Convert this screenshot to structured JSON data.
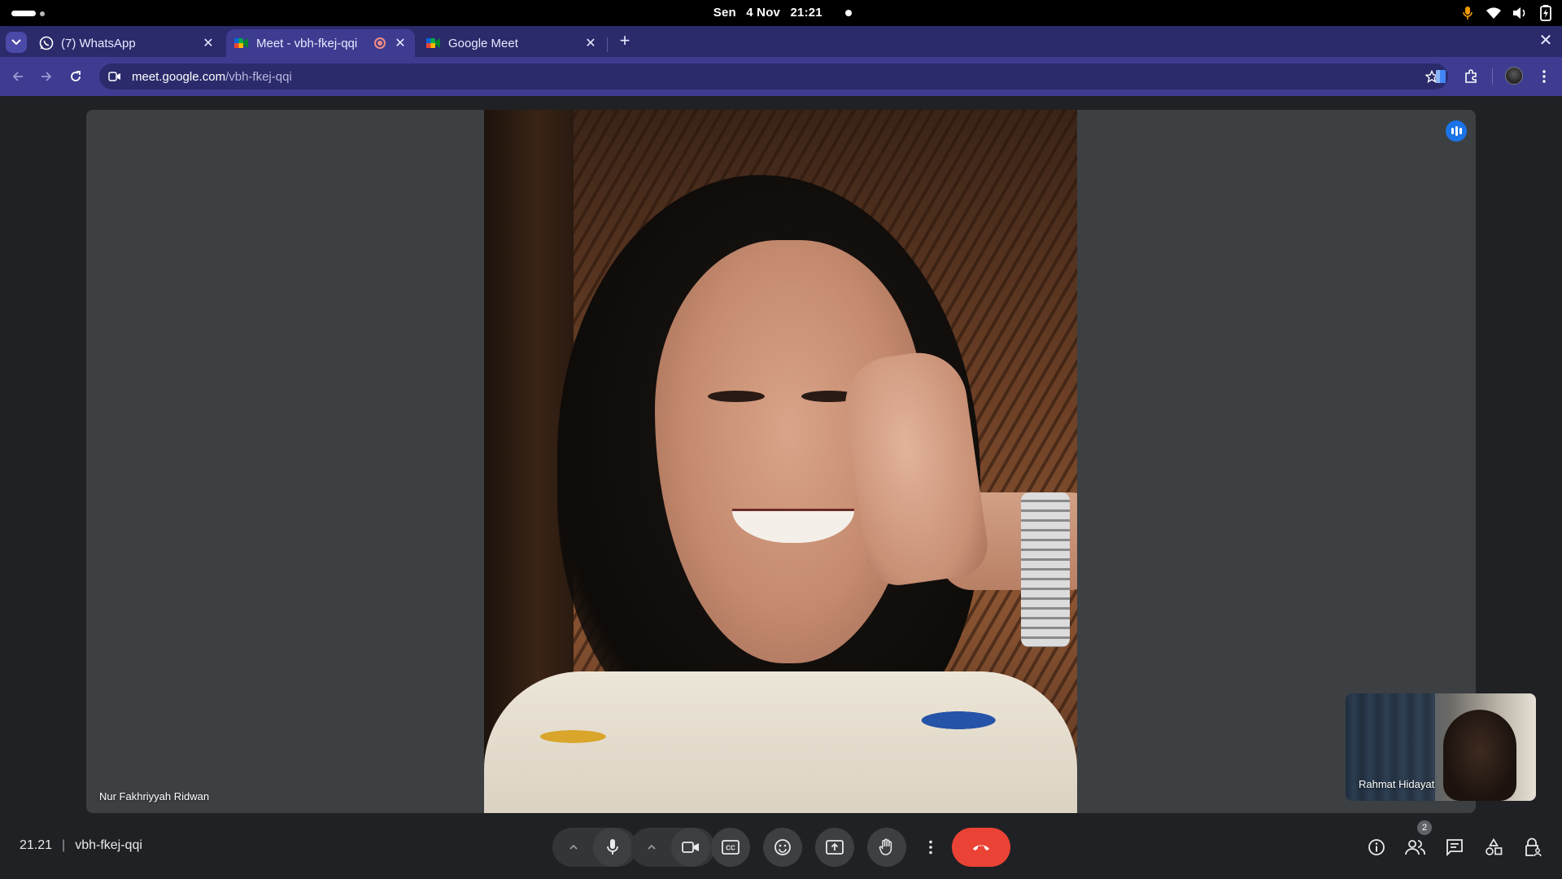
{
  "system_bar": {
    "day": "Sen",
    "date": "4 Nov",
    "time": "21:21"
  },
  "tabs": [
    {
      "title": "(7) WhatsApp",
      "favicon": "whatsapp-icon",
      "active": false
    },
    {
      "title": "Meet - vbh-fkej-qqi",
      "favicon": "google-meet-icon",
      "active": true,
      "recording": true
    },
    {
      "title": "Google Meet",
      "favicon": "google-meet-icon",
      "active": false
    }
  ],
  "address_bar": {
    "host": "meet.google.com",
    "path": "/vbh-fkej-qqi"
  },
  "meeting": {
    "main_participant": "Nur Fakhriyyah Ridwan",
    "self_participant": "Rahmat Hidayat",
    "clock": "21.21",
    "code": "vbh-fkej-qqi",
    "participant_count": "2"
  },
  "colors": {
    "tab_strip": "#2b2a6b",
    "toolbar": "#3d3c91",
    "stage": "#3c4043",
    "leave_button": "#ea4335",
    "speaking_indicator": "#1a73e8"
  }
}
